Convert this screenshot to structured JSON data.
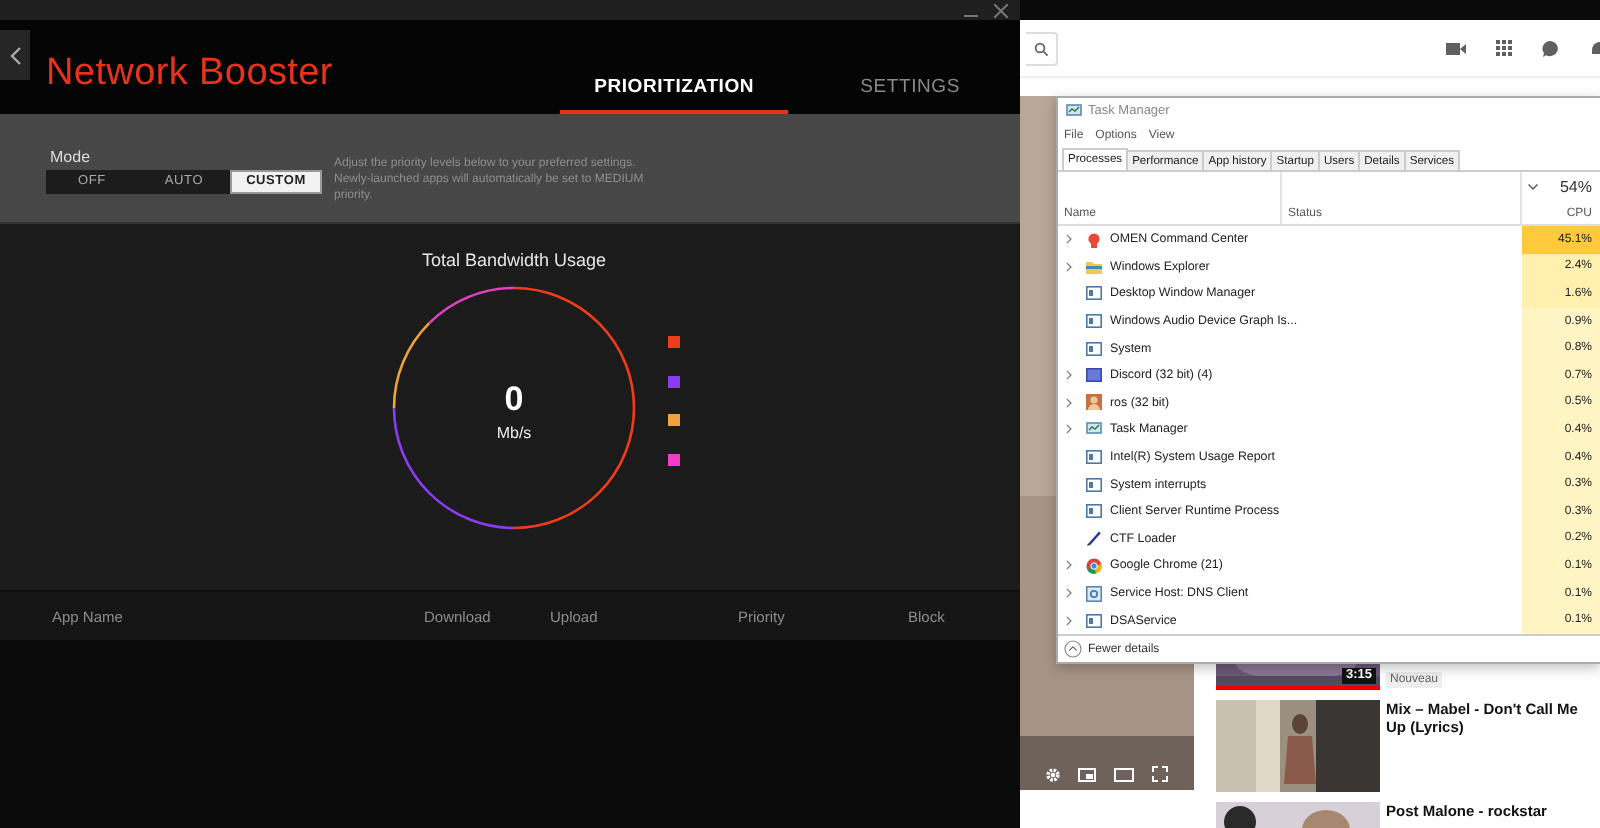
{
  "app": {
    "title": "Network Booster",
    "tabs": [
      {
        "label": "PRIORITIZATION",
        "selected": true
      },
      {
        "label": "SETTINGS",
        "selected": false
      }
    ],
    "mode": {
      "label": "Mode",
      "options": [
        {
          "label": "OFF",
          "selected": false
        },
        {
          "label": "AUTO",
          "selected": false
        },
        {
          "label": "CUSTOM",
          "selected": true
        }
      ],
      "description": "Adjust the priority levels below to your preferred settings. Newly-launched apps will automatically be set to MEDIUM priority."
    },
    "bandwidth": {
      "title": "Total Bandwidth Usage",
      "value": "0",
      "unit": "Mb/s",
      "legend": [
        {
          "color": "#f03c1a"
        },
        {
          "color": "#8a3cf0"
        },
        {
          "color": "#f0a03c"
        },
        {
          "color": "#f03cc8"
        }
      ]
    },
    "table": {
      "columns": [
        "App Name",
        "Download",
        "Upload",
        "Priority",
        "Block"
      ]
    }
  },
  "task_manager": {
    "title": "Task Manager",
    "menu": [
      "File",
      "Options",
      "View"
    ],
    "tabs": [
      {
        "label": "Processes",
        "selected": true
      },
      {
        "label": "Performance",
        "selected": false
      },
      {
        "label": "App history",
        "selected": false
      },
      {
        "label": "Startup",
        "selected": false
      },
      {
        "label": "Users",
        "selected": false
      },
      {
        "label": "Details",
        "selected": false
      },
      {
        "label": "Services",
        "selected": false
      }
    ],
    "columns": {
      "name": "Name",
      "status": "Status",
      "cpu_total": "54%",
      "cpu": "CPU"
    },
    "rows": [
      {
        "kind": "app",
        "name": "OMEN Command Center",
        "cpu": "45.1%",
        "expandable": true,
        "color": "#ffc83d"
      },
      {
        "kind": "folder",
        "name": "Windows Explorer",
        "cpu": "2.4%",
        "expandable": true,
        "color": "#fff0b0"
      },
      {
        "kind": "service",
        "name": "Desktop Window Manager",
        "cpu": "1.6%",
        "expandable": false,
        "color": "#fff0b0"
      },
      {
        "kind": "service",
        "name": "Windows Audio Device Graph Is...",
        "cpu": "0.9%",
        "expandable": false,
        "color": "#fff4c4"
      },
      {
        "kind": "service",
        "name": "System",
        "cpu": "0.8%",
        "expandable": false,
        "color": "#fff4c4"
      },
      {
        "kind": "chat",
        "name": "Discord (32 bit) (4)",
        "cpu": "0.7%",
        "expandable": true,
        "color": "#fff4c4"
      },
      {
        "kind": "avatar",
        "name": "ros (32 bit)",
        "cpu": "0.5%",
        "expandable": true,
        "color": "#fff4c4"
      },
      {
        "kind": "monitor",
        "name": "Task Manager",
        "cpu": "0.4%",
        "expandable": true,
        "color": "#fff4c4"
      },
      {
        "kind": "service",
        "name": "Intel(R) System Usage Report",
        "cpu": "0.4%",
        "expandable": false,
        "color": "#fff4c4"
      },
      {
        "kind": "service",
        "name": "System interrupts",
        "cpu": "0.3%",
        "expandable": false,
        "color": "#fff4c4"
      },
      {
        "kind": "service",
        "name": "Client Server Runtime Process",
        "cpu": "0.3%",
        "expandable": false,
        "color": "#fff4c4"
      },
      {
        "kind": "pen",
        "name": "CTF Loader",
        "cpu": "0.2%",
        "expandable": false,
        "color": "#fff4c4"
      },
      {
        "kind": "browser",
        "name": "Google Chrome (21)",
        "cpu": "0.1%",
        "expandable": true,
        "color": "#fff4c4"
      },
      {
        "kind": "gear",
        "name": "Service Host: DNS Client",
        "cpu": "0.1%",
        "expandable": true,
        "color": "#fff4c4"
      },
      {
        "kind": "service",
        "name": "DSAService",
        "cpu": "0.1%",
        "expandable": true,
        "color": "#fff4c4"
      }
    ],
    "footer": "Fewer details"
  },
  "browser": {
    "videos": [
      {
        "duration": "3:15",
        "badge": "Nouveau",
        "level": 1
      },
      {
        "title": "Mix – Mabel - Don't Call Me Up (Lyrics)"
      },
      {
        "title": "Post Malone - rockstar"
      }
    ]
  }
}
